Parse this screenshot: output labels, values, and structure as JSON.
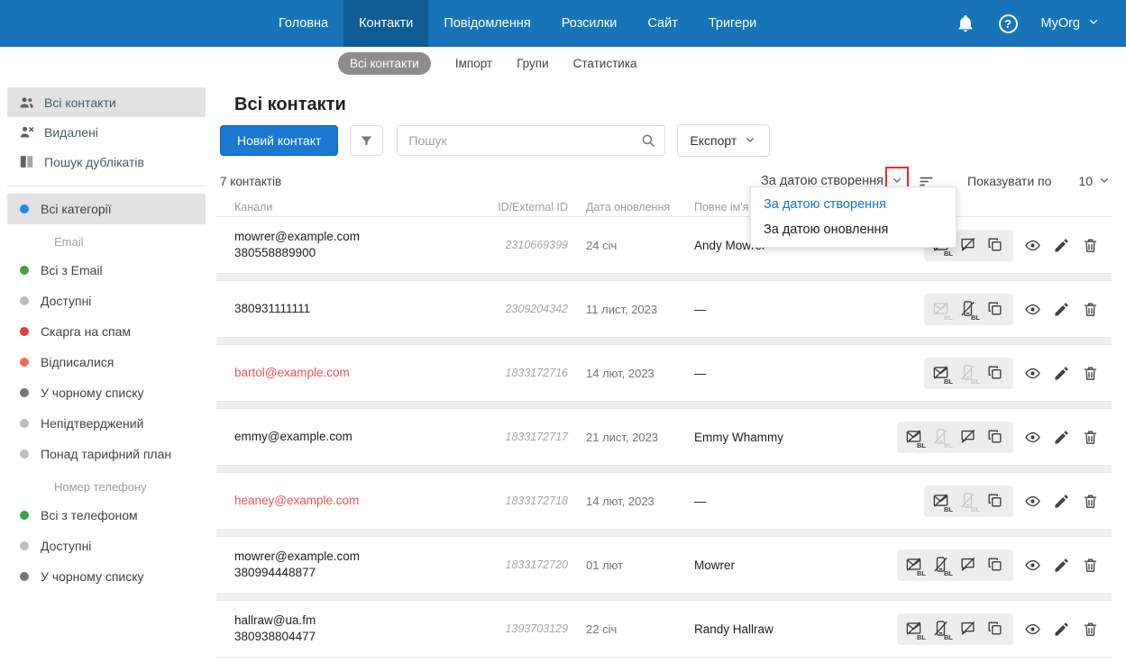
{
  "annotation": {
    "color": "#f5222d"
  },
  "nav": {
    "items": [
      "Головна",
      "Контакти",
      "Повідомлення",
      "Розсилки",
      "Сайт",
      "Тригери"
    ],
    "active_index": 1,
    "help_glyph": "?",
    "org_label": "MyOrg"
  },
  "subnav": {
    "items": [
      "Всі контакти",
      "Імпорт",
      "Групи",
      "Статистика"
    ],
    "active_index": 0
  },
  "sidebar": {
    "main_items": [
      {
        "label": "Всі контакти",
        "selected": true
      },
      {
        "label": "Видалені",
        "selected": false
      },
      {
        "label": "Пошук дублікатів",
        "selected": false
      }
    ],
    "categories": [
      {
        "type": "item",
        "label": "Всі категорії",
        "dot": "#1e88e5",
        "selected": true
      },
      {
        "type": "group",
        "label": "Email"
      },
      {
        "type": "item",
        "label": "Всі з Email",
        "dot": "#43a047",
        "selected": false
      },
      {
        "type": "item",
        "label": "Доступні",
        "dot": "#bdbdbd",
        "selected": false
      },
      {
        "type": "item",
        "label": "Скарга на спам",
        "dot": "#e53935",
        "selected": false
      },
      {
        "type": "item",
        "label": "Відписалися",
        "dot": "#ef6e62",
        "selected": false
      },
      {
        "type": "item",
        "label": "У чорному списку",
        "dot": "#757575",
        "selected": false
      },
      {
        "type": "item",
        "label": "Непідтверджений",
        "dot": "#bdbdbd",
        "selected": false
      },
      {
        "type": "item",
        "label": "Понад тарифний план",
        "dot": "#bdbdbd",
        "selected": false
      },
      {
        "type": "group",
        "label": "Номер телефону"
      },
      {
        "type": "item",
        "label": "Всі з телефоном",
        "dot": "#43a047",
        "selected": false
      },
      {
        "type": "item",
        "label": "Доступні",
        "dot": "#bdbdbd",
        "selected": false
      },
      {
        "type": "item",
        "label": "У чорному списку",
        "dot": "#757575",
        "selected": false
      }
    ]
  },
  "page": {
    "title": "Всі контакти"
  },
  "toolbar": {
    "new_contact_label": "Новий контакт",
    "search_placeholder": "Пошук",
    "export_label": "Експорт",
    "count_label": "7 контактів",
    "sort_value": "За датою створення",
    "show_label": "Показувати по",
    "page_size": "10"
  },
  "sort_dropdown": {
    "options": [
      {
        "label": "За датою створення",
        "selected": true
      },
      {
        "label": "За датою оновлення",
        "selected": false
      }
    ]
  },
  "table": {
    "headers": {
      "channels": "Канали",
      "id": "ID/External ID",
      "updated": "Дата оновлення",
      "name": "Повне ім'я"
    },
    "rows": [
      {
        "channel1": "mowrer@example.com",
        "channel2": "380558889900",
        "id": "2310669399",
        "updated": "24 січ",
        "name": "Andy Mowrer",
        "danger": false,
        "channel_icons": [
          {
            "name": "email-blacklist",
            "badge": "BL",
            "state": "active"
          },
          {
            "name": "chat-blocked",
            "badge": "",
            "state": "active"
          },
          {
            "name": "copy",
            "badge": "",
            "state": "active"
          }
        ]
      },
      {
        "channel1": "380931111111",
        "channel2": "",
        "id": "2309204342",
        "updated": "11 лист, 2023",
        "name": "—",
        "danger": false,
        "channel_icons": [
          {
            "name": "email-blacklist",
            "badge": "BL",
            "state": "disabled"
          },
          {
            "name": "phone-blacklist",
            "badge": "BL",
            "state": "active"
          },
          {
            "name": "copy",
            "badge": "",
            "state": "active"
          }
        ]
      },
      {
        "channel1": "bartol@example.com",
        "channel2": "",
        "id": "1833172716",
        "updated": "14 лют, 2023",
        "name": "—",
        "danger": true,
        "channel_icons": [
          {
            "name": "email-blacklist",
            "badge": "BL",
            "state": "active"
          },
          {
            "name": "phone-blacklist",
            "badge": "BL",
            "state": "disabled"
          },
          {
            "name": "copy",
            "badge": "",
            "state": "active"
          }
        ]
      },
      {
        "channel1": "emmy@example.com",
        "channel2": "",
        "id": "1833172717",
        "updated": "21 лист, 2023",
        "name": "Emmy Whammy",
        "danger": false,
        "channel_icons": [
          {
            "name": "email-blacklist",
            "badge": "BL",
            "state": "active"
          },
          {
            "name": "phone-blacklist",
            "badge": "BL",
            "state": "disabled"
          },
          {
            "name": "chat-blocked",
            "badge": "",
            "state": "active"
          },
          {
            "name": "copy",
            "badge": "",
            "state": "active"
          }
        ]
      },
      {
        "channel1": "heaney@example.com",
        "channel2": "",
        "id": "1833172718",
        "updated": "14 лют, 2023",
        "name": "—",
        "danger": true,
        "channel_icons": [
          {
            "name": "email-blacklist",
            "badge": "BL",
            "state": "active"
          },
          {
            "name": "phone-blacklist",
            "badge": "BL",
            "state": "disabled"
          },
          {
            "name": "copy",
            "badge": "",
            "state": "active"
          }
        ]
      },
      {
        "channel1": "mowrer@example.com",
        "channel2": "380994448877",
        "id": "1833172720",
        "updated": "01 лют",
        "name": "Mowrer",
        "danger": false,
        "channel_icons": [
          {
            "name": "email-blacklist",
            "badge": "BL",
            "state": "active"
          },
          {
            "name": "phone-blacklist",
            "badge": "BL",
            "state": "active"
          },
          {
            "name": "chat-blocked",
            "badge": "",
            "state": "active"
          },
          {
            "name": "copy",
            "badge": "",
            "state": "active"
          }
        ]
      },
      {
        "channel1": "hallraw@ua.fm",
        "channel2": "380938804477",
        "id": "1393703129",
        "updated": "22 січ",
        "name": "Randy Hallraw",
        "danger": false,
        "channel_icons": [
          {
            "name": "email-blacklist",
            "badge": "BL",
            "state": "active"
          },
          {
            "name": "phone-blacklist",
            "badge": "BL",
            "state": "active"
          },
          {
            "name": "chat-blocked",
            "badge": "",
            "state": "active"
          },
          {
            "name": "copy",
            "badge": "",
            "state": "active"
          }
        ]
      }
    ]
  }
}
